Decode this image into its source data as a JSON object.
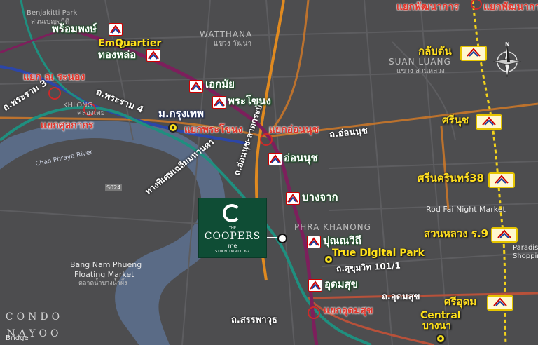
{
  "watermark": {
    "line1": "CONDO",
    "line2": "NAYOO"
  },
  "project_logo": {
    "the": "THE",
    "name": "COOPERS",
    "suffix": "me",
    "tagline": "SUKHUMVIT 62"
  },
  "lines": {
    "green": "#1f8f7f",
    "blue": "#1f3fa0",
    "yellow": "#f2d21b",
    "purple": "#8a2468",
    "orange": "#e88a1f",
    "red_road": "#c9482c"
  },
  "green_line_stations": [
    {
      "label": "พร้อมพงษ์",
      "icon": "srt-train-icon"
    },
    {
      "label": "ทองหล่อ",
      "icon": "srt-train-icon"
    },
    {
      "label": "เอกมัย",
      "icon": "srt-train-icon"
    },
    {
      "label": "พระโขนง",
      "icon": "srt-train-icon"
    },
    {
      "label": "อ่อนนุช",
      "icon": "srt-train-icon"
    },
    {
      "label": "บางจาก",
      "icon": "srt-train-icon"
    },
    {
      "label": "ปุณณวิถี",
      "icon": "srt-train-icon"
    },
    {
      "label": "อุดมสุข",
      "icon": "srt-train-icon"
    }
  ],
  "yellow_line_stations": [
    {
      "label": "กลับตัน",
      "icon": "srt-train-icon"
    },
    {
      "label": "ศรีนุช",
      "icon": "srt-train-icon"
    },
    {
      "label": "ศรีนครินทร์38",
      "icon": "srt-train-icon"
    },
    {
      "label": "สวนหลวง ร.9",
      "icon": "srt-train-icon"
    },
    {
      "label": "ศรีอุดม",
      "icon": "srt-train-icon"
    }
  ],
  "blue_line_station": {
    "label": "ม.กรุงเทพ"
  },
  "places": {
    "emquartier": "EmQuartier",
    "true_digital_park": "True Digital Park",
    "central": "Central",
    "bangna": "บางนา"
  },
  "junctions": {
    "na_ranong": "แยก ณ ระนอง",
    "sukhaphiban": "แยกศุลกากร",
    "phra_khanong": "แยกพระโขนง",
    "on_nut": "แยกอ่อนนุช",
    "udomsuk": "แยกอุดมสุข",
    "phatthanakan": "แยกพัฒนาการ"
  },
  "roads": {
    "rama3": "ถ.พระราม 3",
    "rama4": "ถ.พระราม 4",
    "on_nut_road": "ถ.อ่อนนุช",
    "udomsuk_road": "ถ.อุดมสุข",
    "sukhumvit_101_1": "ถ.สุขุมวิท 101/1",
    "sanphawut": "ถ.สรรพาวุธ",
    "expressway": "ทางพิเศษเฉลิมมหานคร",
    "onnut_lat_krabang": "ถ.อ่อนนุช-ลาดกระบัง"
  },
  "map_text": {
    "benjakitti": "Benjakitti Park",
    "benjakitti_th": "สวนเบญจกิติ",
    "khlong_toei": "KHLONG",
    "khlong_toei_th": "คลองเตย",
    "watthana": "WATTHANA",
    "watthana_th": "แขวง วัฒนา",
    "suan_luang": "SUAN LUANG",
    "suan_luang_th": "แขวง สวนหลวง",
    "phra_khanong_area": "PHRA KHANONG",
    "rod_fai": "Rod Fai Night Market",
    "paradise": "Paradise",
    "shopping": "Shoppin",
    "bang_nam_phueng": "Bang Nam Phueng",
    "floating_market": "Floating Market",
    "floating_market_th": "ตลาดน้ำบางน้ำผึ้ง",
    "chao_phraya": "Chao Phraya River",
    "bridge": "Bridge",
    "s024": "S024"
  }
}
